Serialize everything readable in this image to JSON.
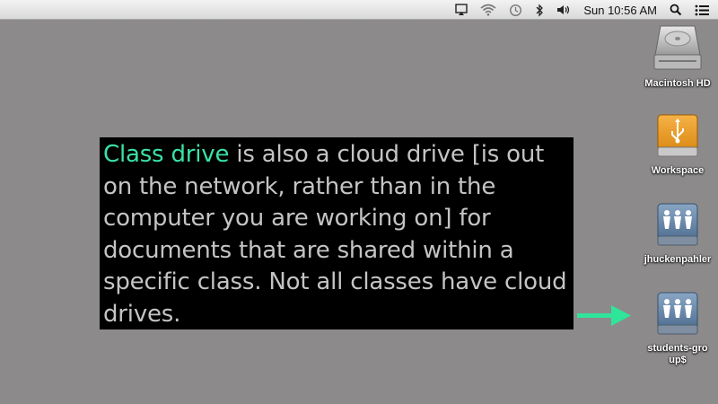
{
  "menubar": {
    "clock": "Sun 10:56 AM",
    "icons": [
      "airplay-icon",
      "wifi-icon",
      "time-machine-icon",
      "bluetooth-icon",
      "volume-icon",
      "spotlight-search-icon",
      "notification-center-icon"
    ]
  },
  "caption": {
    "highlight": "Class drive",
    "text": " is also a cloud drive [is out on the network, rather than in the computer you are working on] for documents that are shared within a specific class. Not all classes have cloud drives.",
    "highlight_color": "#3ae2a6",
    "text_color": "#c4c4c4"
  },
  "desktop": {
    "icons": [
      {
        "label": "Macintosh HD",
        "icon": "hard-drive-icon"
      },
      {
        "label": "Workspace",
        "icon": "usb-drive-icon"
      },
      {
        "label": "jhuckenpahler",
        "icon": "network-share-icon"
      },
      {
        "label": "students-group$",
        "icon": "network-share-icon"
      }
    ]
  },
  "arrow_color": "#2ee59a"
}
